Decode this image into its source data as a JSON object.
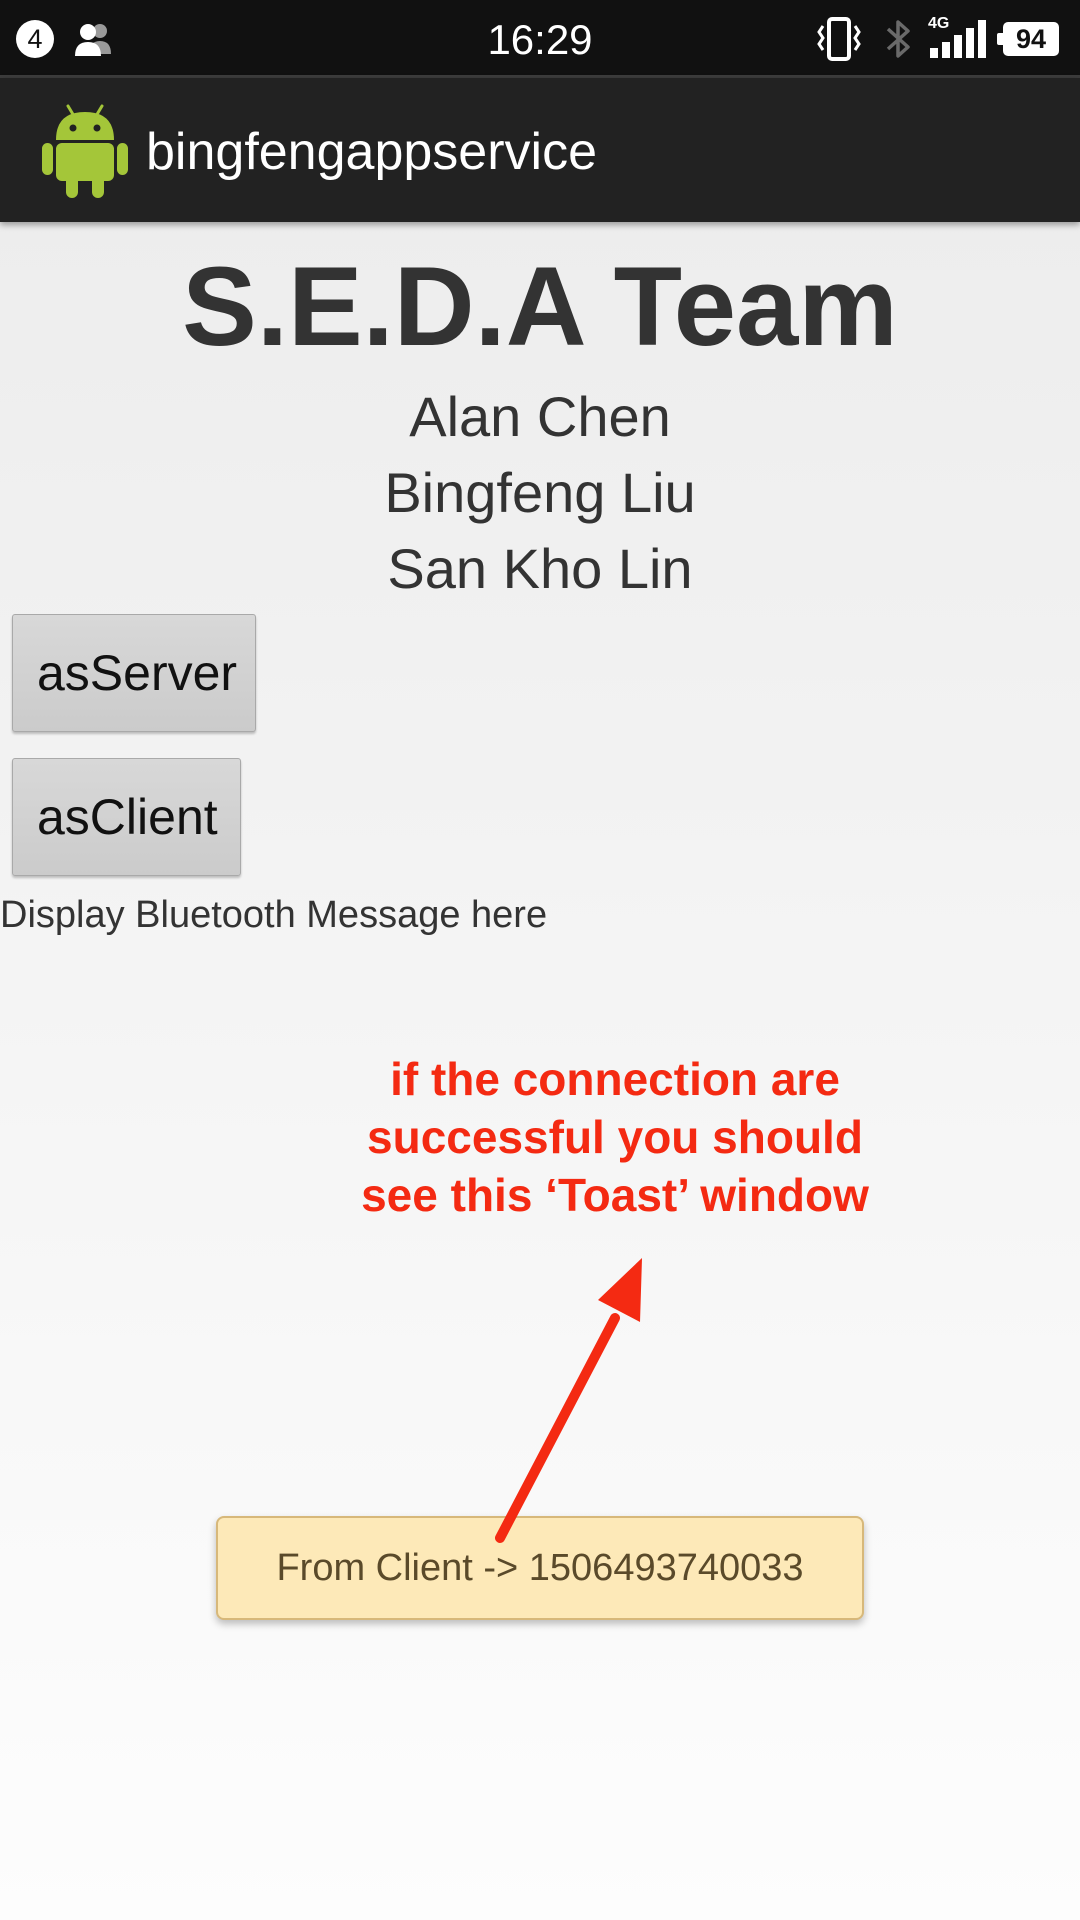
{
  "status_bar": {
    "notification_count": "4",
    "time": "16:29",
    "network_type": "4G",
    "battery_level": "94"
  },
  "action_bar": {
    "app_title": "bingfengappservice"
  },
  "main": {
    "team_title": "S.E.D.A Team",
    "members": [
      "Alan Chen",
      "Bingfeng Liu",
      "San Kho Lin"
    ],
    "server_button_label": "asServer",
    "client_button_label": "asClient",
    "bluetooth_message": "Display Bluetooth Message here"
  },
  "annotation": {
    "lines": [
      "if the connection are",
      "successful you should",
      "see this ‘Toast’ window"
    ],
    "color": "#f42a12"
  },
  "toast": {
    "message": "From Client -> 1506493740033"
  },
  "icons": {
    "status_left": [
      "contacts-icon"
    ],
    "status_right": [
      "vibrate-icon",
      "bluetooth-icon",
      "signal-icon",
      "battery-icon"
    ],
    "app": "android-robot-icon"
  },
  "colors": {
    "status_bar_bg": "#111111",
    "action_bar_bg": "#222222",
    "toast_bg": "#fde9b8",
    "annotation_red": "#f42a12"
  }
}
